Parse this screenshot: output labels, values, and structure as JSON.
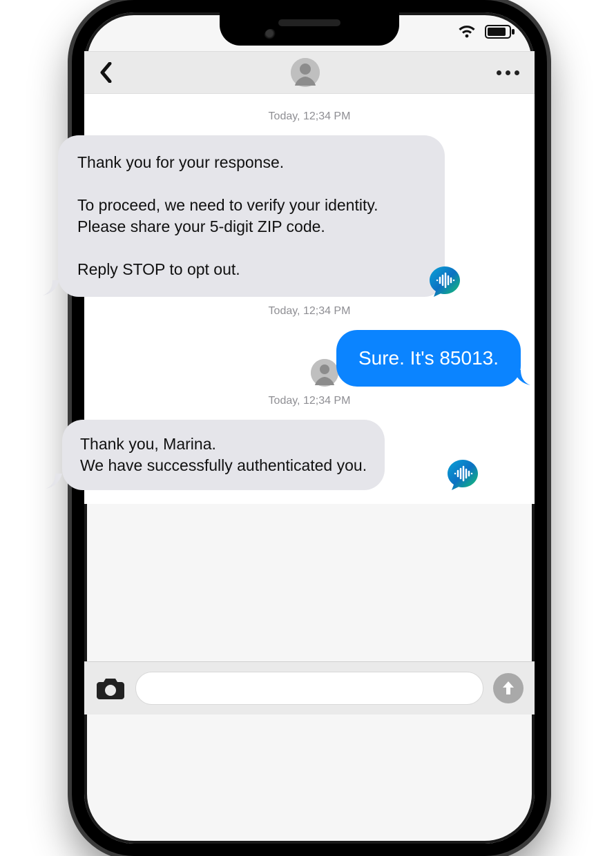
{
  "timestamps": {
    "t1": "Today, 12;34 PM",
    "t2": "Today, 12;34 PM",
    "t3": "Today, 12;34 PM"
  },
  "messages": {
    "incoming1": "Thank you for your response.\n\nTo proceed, we need to verify your identity. Please share your 5-digit ZIP code.\n\nReply STOP to opt out.",
    "outgoing1": "Sure. It's 85013.",
    "incoming2": "Thank you, Marina.\nWe have successfully authenticated you."
  },
  "icons": {
    "wifi": "wifi-icon",
    "battery": "battery-icon",
    "back": "back-chevron-icon",
    "contact": "contact-avatar-icon",
    "more": "more-options-icon",
    "camera": "camera-icon",
    "send": "send-up-arrow-icon",
    "brand": "waveform-chat-icon"
  },
  "compose": {
    "placeholder": ""
  }
}
